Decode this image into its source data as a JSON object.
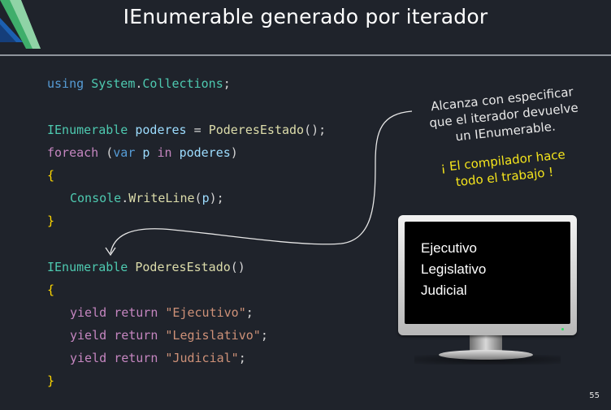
{
  "slide": {
    "title": "IEnumerable generado por iterador",
    "page_number": "55"
  },
  "code": {
    "l1": {
      "k": "using",
      "ns1": "System",
      "dot": ".",
      "ns2": "Collections",
      "end": ";"
    },
    "l2": {
      "type": "IEnumerable",
      "var": "poderes",
      "op": " = ",
      "call": "PoderesEstado",
      "end": "();"
    },
    "l3": {
      "kw": "foreach",
      "open": " (",
      "kw2": "var",
      "v": "p",
      "in": "in",
      "coll": "poderes",
      "close": ")"
    },
    "l4": {
      "brace": "{"
    },
    "l5": {
      "cls": "Console",
      "dot": ".",
      "fn": "WriteLine",
      "open": "(",
      "arg": "p",
      "close": ");"
    },
    "l6": {
      "brace": "}"
    },
    "l7": {
      "type": "IEnumerable",
      "fn": "PoderesEstado",
      "paren": "()"
    },
    "l8": {
      "brace": "{"
    },
    "l9": {
      "y": "yield",
      "r": "return",
      "s": "\"Ejecutivo\"",
      "end": ";"
    },
    "l10": {
      "y": "yield",
      "r": "return",
      "s": "\"Legislativo\"",
      "end": ";"
    },
    "l11": {
      "y": "yield",
      "r": "return",
      "s": "\"Judicial\"",
      "end": ";"
    },
    "l12": {
      "brace": "}"
    }
  },
  "annotation": {
    "line1": "Alcanza con especificar",
    "line2": "que el iterador devuelve",
    "line3": "un IEnumerable.",
    "yellow1": "¡ El compilador hace",
    "yellow2": "todo el trabajo !"
  },
  "monitor": {
    "output": [
      "Ejecutivo",
      "Legislativo",
      "Judicial"
    ]
  },
  "colors": {
    "background": "#1f232b",
    "keyword": "#569cd6",
    "control": "#c586c0",
    "type": "#4ec9b0",
    "function": "#dcdcaa",
    "variable": "#9cdcfe",
    "string": "#ce9178",
    "brace": "#ffd700",
    "highlight": "#f5e51c"
  }
}
